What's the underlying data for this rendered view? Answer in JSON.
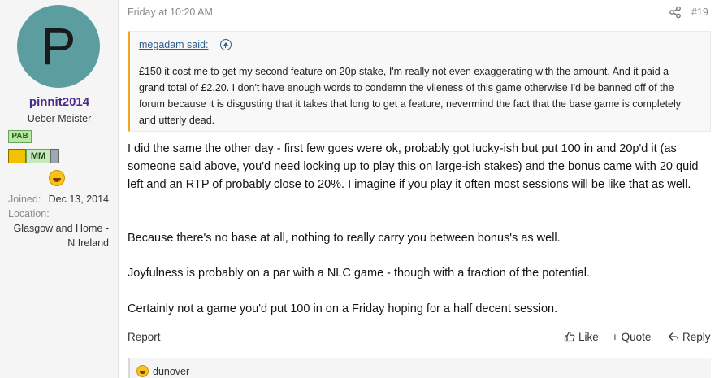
{
  "sidebar": {
    "avatar_letter": "P",
    "avatar_color": "#5c9ea0",
    "username": "pinnit2014",
    "username_color": "#4b2a8a",
    "user_title": "Ueber Meister",
    "badges": [
      "PAB",
      "MM"
    ],
    "reaction_icon": "laughing-emoji",
    "joined_label": "Joined:",
    "joined_value": "Dec 13, 2014",
    "location_label": "Location:",
    "location_line1": "Glasgow and Home -",
    "location_line2": "N Ireland"
  },
  "post": {
    "date": "Friday at 10:20 AM",
    "share_icon": "share-icon",
    "number": "#19",
    "quote": {
      "author": "megadam said:",
      "text": "£150 it cost me to get my second feature on 20p stake, I'm really not even exaggerating with the amount. And it paid a grand total of £2.20. I don't have enough words to condemn the vileness of this game otherwise I'd be banned off of the forum because it is disgusting that it takes that long to get a feature, nevermind the fact that the base game is completely and utterly dead.",
      "accent_color": "#f3a623"
    },
    "paragraphs": [
      "I did the same the other day - first few goes were ok, probably got lucky-ish but put 100 in and 20p'd it (as someone said above, you'd need locking up to play this on large-ish stakes) and the bonus came with 20 quid left and an RTP of probably close to 20%. I imagine if you play it often most sessions will be like that as well.",
      "Because there's no base at all, nothing to really carry you between bonus's as well.",
      "Joyfulness is probably on a par with a NLC game - though with a fraction of the potential.",
      "Certainly not a game you'd put 100 in on a Friday hoping for a half decent session."
    ],
    "actions": {
      "report": "Report",
      "like": "Like",
      "quote": "+ Quote",
      "reply": "Reply"
    },
    "reactions": {
      "icon": "grinning-emoji",
      "users": "dunover"
    }
  }
}
